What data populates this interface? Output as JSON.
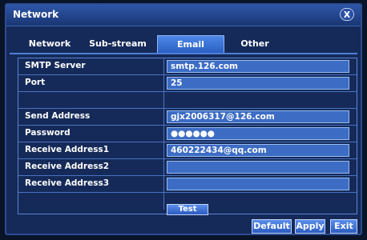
{
  "window": {
    "title": "Network",
    "close_icon_glyph": "X"
  },
  "tabs": [
    {
      "label": "Network",
      "active": false
    },
    {
      "label": "Sub-stream",
      "active": false
    },
    {
      "label": "Email",
      "active": true
    },
    {
      "label": "Other",
      "active": false
    }
  ],
  "form": {
    "rows": [
      {
        "label": "SMTP Server",
        "value": "smtp.126.com"
      },
      {
        "label": "Port",
        "value": "25"
      },
      {
        "label": "",
        "value": ""
      },
      {
        "label": "Send Address",
        "value": "gjx2006317@126.com"
      },
      {
        "label": "Password",
        "value": "●●●●●●"
      },
      {
        "label": "Receive Address1",
        "value": "460222434@qq.com"
      },
      {
        "label": "Receive Address2",
        "value": ""
      },
      {
        "label": "Receive Address3",
        "value": ""
      }
    ],
    "test_label": "Test"
  },
  "buttons": {
    "default": "Default",
    "apply": "Apply",
    "exit": "Exit"
  },
  "colors": {
    "background": "#152a58",
    "field": "#3c6cc4",
    "active_tab": "#4e88e8",
    "border": "#4a72c2"
  }
}
